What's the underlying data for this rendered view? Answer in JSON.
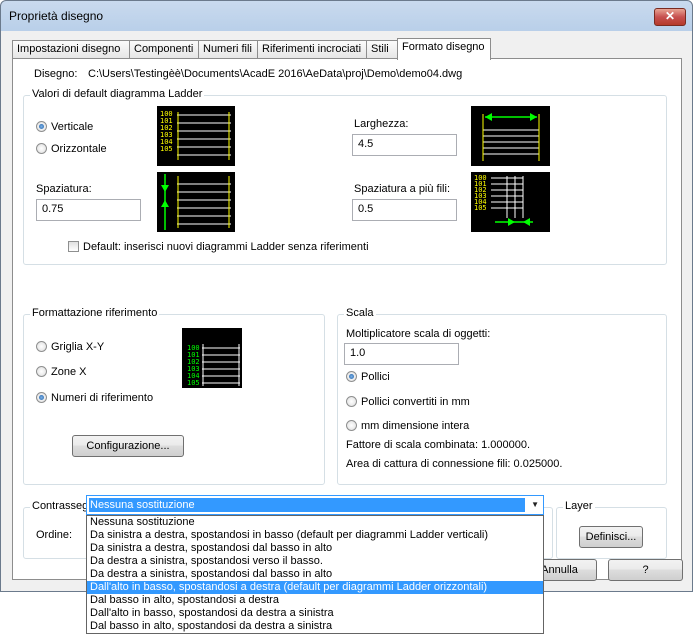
{
  "window": {
    "title": "Proprietà disegno",
    "close_label": "✕"
  },
  "tabs": [
    {
      "label": "Impostazioni disegno"
    },
    {
      "label": "Componenti"
    },
    {
      "label": "Numeri fili"
    },
    {
      "label": "Riferimenti incrociati"
    },
    {
      "label": "Stili"
    },
    {
      "label": "Formato disegno",
      "active": true
    }
  ],
  "drawing": {
    "label": "Disegno:",
    "path": "C:\\Users\\Testingèè\\Documents\\AcadE 2016\\AeData\\proj\\Demo\\demo04.dwg"
  },
  "ladder": {
    "group_title": "Valori di default diagramma Ladder",
    "orientation_vertical": "Verticale",
    "orientation_horizontal": "Orizzontale",
    "selected_orientation": "vertical",
    "width_label": "Larghezza:",
    "width_value": "4.5",
    "spacing_label": "Spaziatura:",
    "spacing_value": "0.75",
    "multiwire_label": "Spaziatura a più fili:",
    "multiwire_value": "0.5",
    "default_checkbox": "Default: inserisci nuovi diagrammi Ladder senza riferimenti",
    "default_checked": false,
    "preview_numbers": [
      "100",
      "101",
      "102",
      "103",
      "104",
      "105"
    ]
  },
  "ref_format": {
    "group_title": "Formattazione riferimento",
    "options": [
      "Griglia X-Y",
      "Zone X",
      "Numeri di riferimento"
    ],
    "selected": "Numeri di riferimento",
    "config_button": "Configurazione...",
    "preview_numbers": [
      "100",
      "101",
      "102",
      "103",
      "104",
      "105"
    ]
  },
  "scale": {
    "group_title": "Scala",
    "multiplier_label": "Moltiplicatore scala di oggetti:",
    "multiplier_value": "1.0",
    "options": [
      "Pollici",
      "Pollici convertiti in mm",
      "mm dimensione intera"
    ],
    "selected": "Pollici",
    "combined_factor": "Fattore di scala combinata: 1.000000.",
    "capture_area": "Area di cattura di connessione fili: 0.025000."
  },
  "sequence": {
    "group_title": "Contrassegno/Numero del filo/Ordine sequenza fili",
    "order_label": "Ordine:",
    "selected_value": "Nessuna sostituzione",
    "options": [
      "Nessuna sostituzione",
      "Da sinistra a destra, spostandosi in basso (default per diagrammi Ladder verticali)",
      "Da sinistra a destra, spostandosi dal basso in alto",
      "Da destra a sinistra, spostandosi verso il basso.",
      "Da destra a sinistra, spostandosi dal basso in alto",
      "Dall'alto in basso, spostandosi a destra (default per diagrammi Ladder orizzontali)",
      "Dal basso in alto, spostandosi a destra",
      "Dall'alto in basso, spostandosi da destra a sinistra",
      "Dal basso in alto, spostandosi da destra a sinistra"
    ],
    "highlighted_index": 5
  },
  "layer": {
    "group_title": "Layer",
    "define_button": "Definisci..."
  },
  "footer": {
    "cancel_button": "Annulla",
    "help_button": "?"
  },
  "colors": {
    "accent": "#3399ff",
    "preview_text": "#ffff00",
    "preview_arrows": "#00ff00"
  }
}
